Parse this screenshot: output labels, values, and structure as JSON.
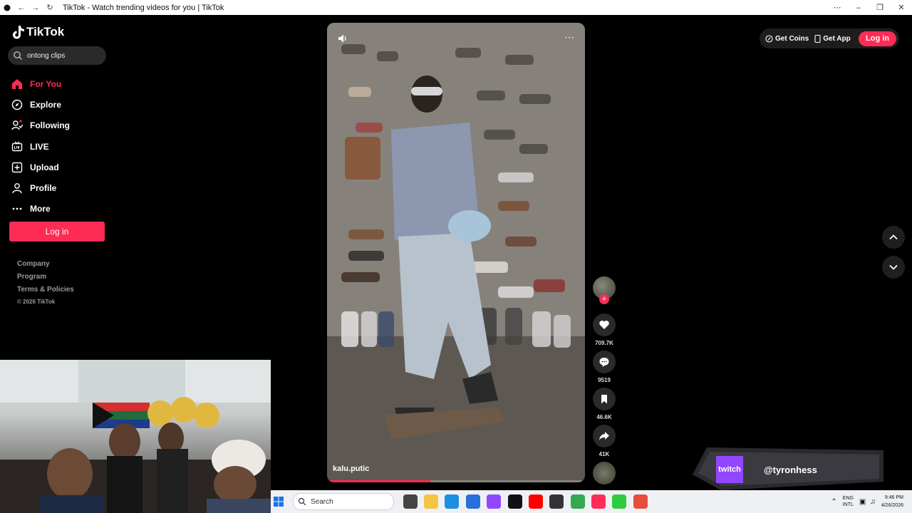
{
  "browser": {
    "tab_title": "TikTok - Watch trending videos for you | TikTok"
  },
  "sidebar": {
    "logo_text": "TikTok",
    "search_value": "ontong clips",
    "nav": [
      {
        "label": "For You",
        "icon": "home-icon",
        "active": true
      },
      {
        "label": "Explore",
        "icon": "compass-icon",
        "active": false
      },
      {
        "label": "Following",
        "icon": "following-icon",
        "active": false
      },
      {
        "label": "LIVE",
        "icon": "live-icon",
        "active": false
      },
      {
        "label": "Upload",
        "icon": "upload-icon",
        "active": false
      },
      {
        "label": "Profile",
        "icon": "profile-icon",
        "active": false
      },
      {
        "label": "More",
        "icon": "more-icon",
        "active": false
      }
    ],
    "login_label": "Log in",
    "footer": {
      "company": "Company",
      "program": "Program",
      "terms": "Terms & Policies",
      "copyright": "© 2026 TikTok"
    }
  },
  "video": {
    "author": "kalu.putic",
    "progress_fraction": 0.4
  },
  "actions": {
    "likes": "709.7K",
    "comments": "9519",
    "saves": "46.6K",
    "shares": "41K"
  },
  "header_right": {
    "get_coins": "Get Coins",
    "get_app": "Get App",
    "login": "Log in"
  },
  "twitch": {
    "badge": "twitch",
    "handle": "@tyronhess"
  },
  "taskbar": {
    "search_label": "Search",
    "lang_top": "ENG",
    "lang_bottom": "INTL",
    "time": "9:46 PM",
    "date": "4/26/2026"
  },
  "colors": {
    "accent": "#fe2c55",
    "twitch": "#9146ff"
  }
}
